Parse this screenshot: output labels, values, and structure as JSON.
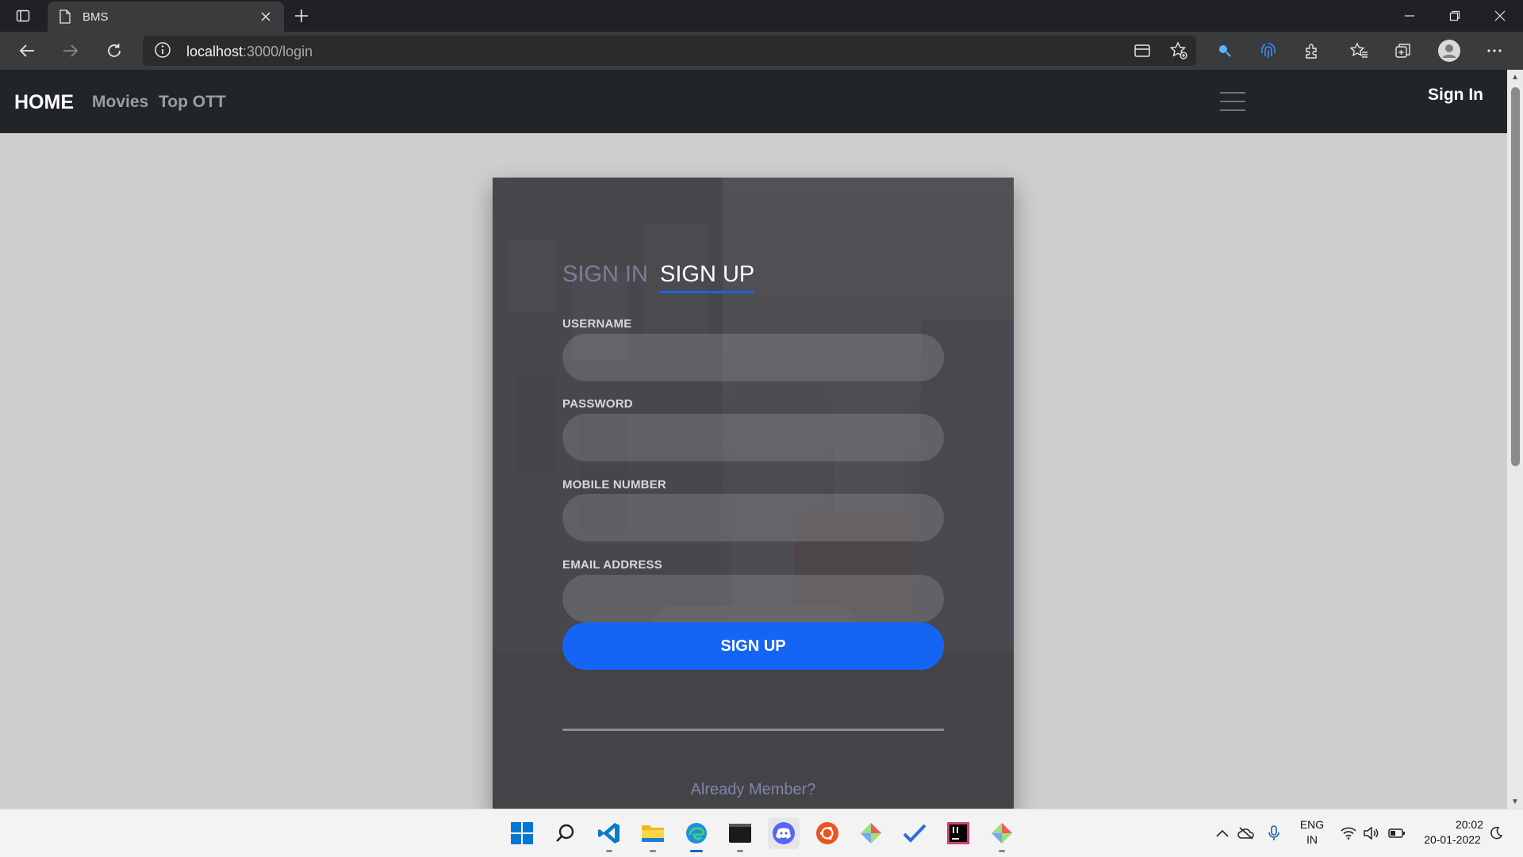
{
  "browser": {
    "tab_title": "BMS",
    "url_host": "localhost",
    "url_path": ":3000/login"
  },
  "site": {
    "brand": "HOME",
    "nav_links": [
      "Movies",
      "Top OTT"
    ],
    "signin_link": "Sign In"
  },
  "form": {
    "tab_signin": "SIGN IN",
    "tab_signup": "SIGN UP",
    "fields": [
      {
        "label": "USERNAME",
        "value": ""
      },
      {
        "label": "PASSWORD",
        "value": ""
      },
      {
        "label": "MOBILE NUMBER",
        "value": ""
      },
      {
        "label": "EMAIL ADDRESS",
        "value": ""
      }
    ],
    "submit_label": "SIGN UP",
    "footer_link": "Already Member?"
  },
  "taskbar": {
    "apps": [
      "start-icon",
      "search-icon",
      "vscode-icon",
      "file-explorer-icon",
      "edge-icon",
      "terminal-icon",
      "discord-icon",
      "ubuntu-icon",
      "git-icon",
      "todo-icon",
      "intellij-icon",
      "git-gui-icon"
    ],
    "language_line1": "ENG",
    "language_line2": "IN",
    "time": "20:02",
    "date": "20-01-2022"
  },
  "colors": {
    "navbar_bg": "#212529",
    "accent_button": "#1565f5",
    "page_bg": "#cfcfcf"
  }
}
